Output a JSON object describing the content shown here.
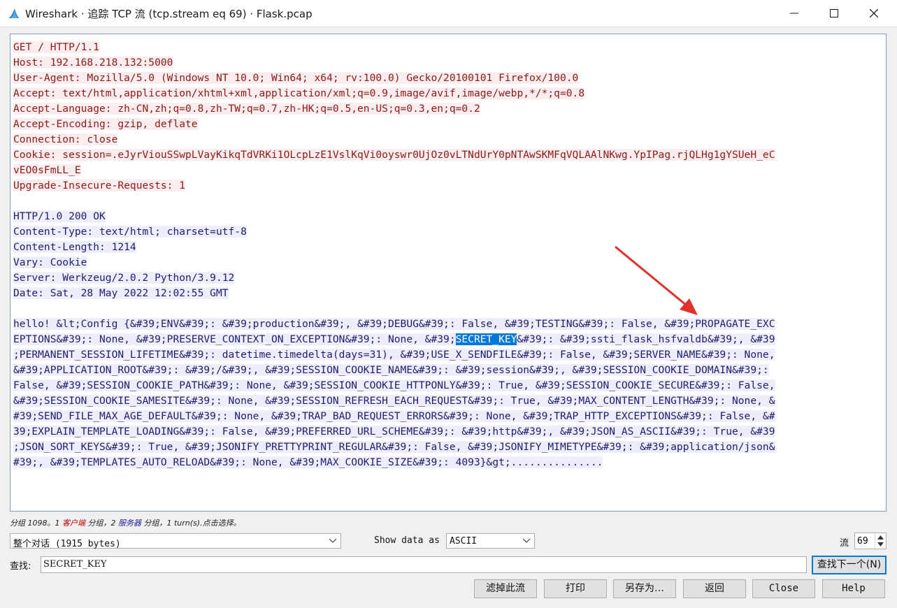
{
  "window": {
    "title": "Wireshark · 追踪 TCP 流 (tcp.stream eq 69) · Flask.pcap"
  },
  "stream": {
    "request_lines": [
      "GET / HTTP/1.1",
      "Host: 192.168.218.132:5000",
      "User-Agent: Mozilla/5.0 (Windows NT 10.0; Win64; x64; rv:100.0) Gecko/20100101 Firefox/100.0",
      "Accept: text/html,application/xhtml+xml,application/xml;q=0.9,image/avif,image/webp,*/*;q=0.8",
      "Accept-Language: zh-CN,zh;q=0.8,zh-TW;q=0.7,zh-HK;q=0.5,en-US;q=0.3,en;q=0.2",
      "Accept-Encoding: gzip, deflate",
      "Connection: close",
      "Cookie: session=.eJyrViouSSwpLVayKikqTdVRKi1OLcpLzE1VslKqVi0oyswr0UjOz0vLTNdUrY0pNTAwSKMFqVQLAAlNKwg.YpIPag.rjQLHg1gYSUeH_eC",
      "vEO0sFmLL_E",
      "Upgrade-Insecure-Requests: 1"
    ],
    "response_lines": [
      "HTTP/1.0 200 OK",
      "Content-Type: text/html; charset=utf-8",
      "Content-Length: 1214",
      "Vary: Cookie",
      "Server: Werkzeug/2.0.2 Python/3.9.12",
      "Date: Sat, 28 May 2022 12:02:55 GMT"
    ],
    "body_line1": "hello! &lt;Config {&#39;ENV&#39;: &#39;production&#39;, &#39;DEBUG&#39;: False, &#39;TESTING&#39;: False, &#39;PROPAGATE_EXC",
    "body_line2_pre": "EPTIONS&#39;: None, &#39;PRESERVE_CONTEXT_ON_EXCEPTION&#39;: None, &#39;",
    "body_line2_hl": "SECRET_KEY",
    "body_line2_post": "&#39;: &#39;ssti_flask_hsfvaldb&#39;, &#39",
    "body_lines_rest": [
      ";PERMANENT_SESSION_LIFETIME&#39;: datetime.timedelta(days=31), &#39;USE_X_SENDFILE&#39;: False, &#39;SERVER_NAME&#39;: None,",
      "&#39;APPLICATION_ROOT&#39;: &#39;/&#39;, &#39;SESSION_COOKIE_NAME&#39;: &#39;session&#39;, &#39;SESSION_COOKIE_DOMAIN&#39;:",
      "False, &#39;SESSION_COOKIE_PATH&#39;: None, &#39;SESSION_COOKIE_HTTPONLY&#39;: True, &#39;SESSION_COOKIE_SECURE&#39;: False,",
      "&#39;SESSION_COOKIE_SAMESITE&#39;: None, &#39;SESSION_REFRESH_EACH_REQUEST&#39;: True, &#39;MAX_CONTENT_LENGTH&#39;: None, &",
      "#39;SEND_FILE_MAX_AGE_DEFAULT&#39;: None, &#39;TRAP_BAD_REQUEST_ERRORS&#39;: None, &#39;TRAP_HTTP_EXCEPTIONS&#39;: False, &#",
      "39;EXPLAIN_TEMPLATE_LOADING&#39;: False, &#39;PREFERRED_URL_SCHEME&#39;: &#39;http&#39;, &#39;JSON_AS_ASCII&#39;: True, &#39",
      ";JSON_SORT_KEYS&#39;: True, &#39;JSONIFY_PRETTYPRINT_REGULAR&#39;: False, &#39;JSONIFY_MIMETYPE&#39;: &#39;application/json&",
      "#39;, &#39;TEMPLATES_AUTO_RELOAD&#39;: None, &#39;MAX_COOKIE_SIZE&#39;: 4093}&gt;..............."
    ]
  },
  "status": {
    "part1": "分组 1098。1 ",
    "client": "客户端",
    "part2": " 分组，2 ",
    "server": "服务器",
    "part3": " 分组，1 turn(s).点击选择。"
  },
  "controls": {
    "conversation_select": "整个对话 (1915 bytes)",
    "show_data_label": "Show data as",
    "show_data_value": "ASCII",
    "stream_label": "流",
    "stream_value": "69",
    "find_label": "查找:",
    "find_value": "SECRET_KEY",
    "find_next_button": "查找下一个(N)"
  },
  "buttons": {
    "filter_out": "滤掉此流",
    "print": "打印",
    "save_as": "另存为…",
    "back": "返回",
    "close": "Close",
    "help": "Help"
  },
  "colors": {
    "client_text": "#8b1a1a",
    "client_bg": "#fbeded",
    "server_text": "#1e1e6e",
    "server_bg": "#ededfb",
    "highlight": "#0078d7",
    "annotation_arrow": "#e0312a"
  }
}
